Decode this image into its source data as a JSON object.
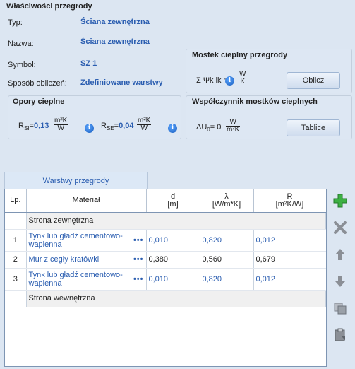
{
  "props": {
    "title": "Właściwości przegrody",
    "typ_label": "Typ:",
    "typ_value": "Ściana zewnętrzna",
    "nazwa_label": "Nazwa:",
    "nazwa_value": "Ściana zewnętrzna",
    "symbol_label": "Symbol:",
    "symbol_value": "SZ 1",
    "sposob_label": "Sposób obliczeń:",
    "sposob_value": "Zdefiniowane warstwy"
  },
  "mostek": {
    "title": "Mostek cieplny przegrody",
    "formula": "Σ Ψk lk =",
    "unit_num": "W",
    "unit_den": "K",
    "button": "Oblicz"
  },
  "opory": {
    "title": "Opory cieplne",
    "rsi_label": "R",
    "rsi_sub": "SI",
    "rsi_value": "0,13",
    "rse_label": "R",
    "rse_sub": "SE",
    "rse_value": "0,04",
    "unit_num": "m²K",
    "unit_den": "W"
  },
  "wspolczynnik": {
    "title": "Współczynnik mostków cieplnych",
    "label": "ΔU",
    "sub": "0",
    "value": "= 0",
    "unit_num": "W",
    "unit_den": "m²K",
    "button": "Tablice"
  },
  "tab": {
    "label": "Warstwy przegrody"
  },
  "table": {
    "headers": {
      "lp": "Lp.",
      "material": "Materiał",
      "d": "d",
      "d_unit": "[m]",
      "lambda": "λ",
      "lambda_unit": "[W/m*K]",
      "r": "R",
      "r_unit": "[m²K/W]"
    },
    "outer": "Strona zewnętrzna",
    "inner": "Strona wewnętrzna",
    "rows": [
      {
        "lp": "1",
        "material": "Tynk lub gładź cementowo-wapienna",
        "dots": "•••",
        "d": "0,010",
        "lambda": "0,820",
        "r": "0,012"
      },
      {
        "lp": "2",
        "material": "Mur z cegły kratówki",
        "dots": "•••",
        "d": "0,380",
        "lambda": "0,560",
        "r": "0,679"
      },
      {
        "lp": "3",
        "material": "Tynk lub gładź cementowo-wapienna",
        "dots": "•••",
        "d": "0,010",
        "lambda": "0,820",
        "r": "0,012"
      }
    ]
  },
  "icons": [
    "add-icon",
    "delete-icon",
    "move-up-icon",
    "move-down-icon",
    "copy-icon",
    "paste-icon",
    "info-icon"
  ]
}
